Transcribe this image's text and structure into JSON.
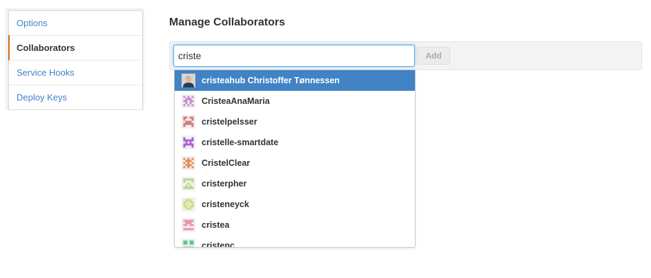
{
  "sidebar": {
    "items": [
      {
        "label": "Options"
      },
      {
        "label": "Collaborators"
      },
      {
        "label": "Service Hooks"
      },
      {
        "label": "Deploy Keys"
      }
    ]
  },
  "main": {
    "heading": "Manage Collaborators",
    "search_value": "criste",
    "add_label": "Add"
  },
  "autocomplete": {
    "items": [
      {
        "label": "cristeahub Christoffer Tønnessen",
        "avatar": "user-photo-avatar"
      },
      {
        "label": "CristeaAnaMaria",
        "avatar": "identicon-avatar",
        "color": "#c98ccf"
      },
      {
        "label": "cristelpelsser",
        "avatar": "identicon-avatar",
        "color": "#d97a7a"
      },
      {
        "label": "cristelle-smartdate",
        "avatar": "identicon-avatar",
        "color": "#b25fd6"
      },
      {
        "label": "CristelClear",
        "avatar": "identicon-avatar",
        "color": "#e58a4e"
      },
      {
        "label": "cristerpher",
        "avatar": "identicon-avatar",
        "color": "#b7d88a"
      },
      {
        "label": "cristeneyck",
        "avatar": "identicon-avatar",
        "color": "#cbe07f"
      },
      {
        "label": "cristea",
        "avatar": "identicon-avatar",
        "color": "#ee8fb6"
      },
      {
        "label": "cristenc",
        "avatar": "identicon-avatar",
        "color": "#57c98d"
      }
    ]
  }
}
